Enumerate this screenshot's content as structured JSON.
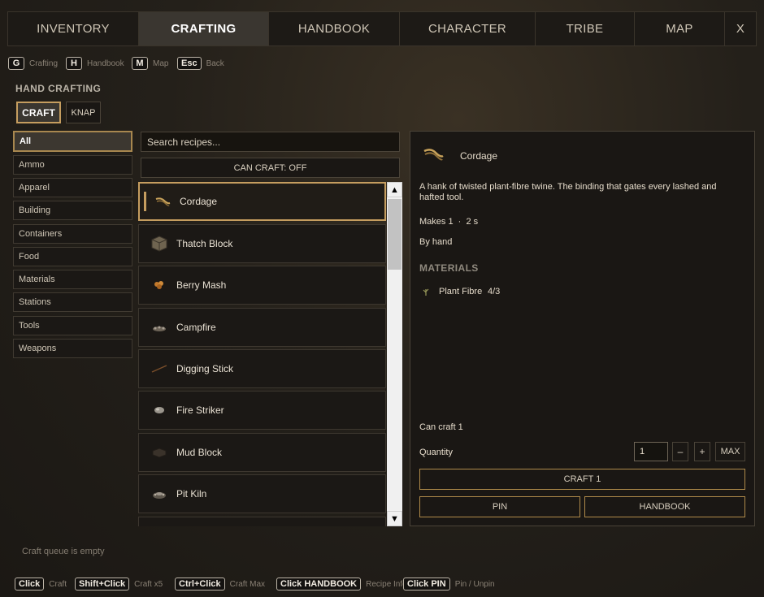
{
  "tabs": [
    "INVENTORY",
    "CRAFTING",
    "HANDBOOK",
    "CHARACTER",
    "TRIBE",
    "MAP"
  ],
  "close_label": "X",
  "key_hints": [
    {
      "key": "G",
      "label": "Crafting"
    },
    {
      "key": "H",
      "label": "Handbook"
    },
    {
      "key": "M",
      "label": "Map"
    },
    {
      "key": "Esc",
      "label": "Back"
    }
  ],
  "section_title": "HAND CRAFTING",
  "mode_buttons": {
    "craft": "CRAFT",
    "knap": "KNAP"
  },
  "categories": [
    "All",
    "Ammo",
    "Apparel",
    "Building",
    "Containers",
    "Food",
    "Materials",
    "Stations",
    "Tools",
    "Weapons"
  ],
  "search_placeholder": "Search recipes...",
  "can_craft_filter": "CAN CRAFT: OFF",
  "recipes": [
    {
      "name": "Cordage",
      "icon": "cordage-icon"
    },
    {
      "name": "Thatch Block",
      "icon": "thatch-block-icon"
    },
    {
      "name": "Berry Mash",
      "icon": "berry-mash-icon"
    },
    {
      "name": "Campfire",
      "icon": "campfire-icon"
    },
    {
      "name": "Digging Stick",
      "icon": "digging-stick-icon"
    },
    {
      "name": "Fire Striker",
      "icon": "fire-striker-icon"
    },
    {
      "name": "Mud Block",
      "icon": "mud-block-icon"
    },
    {
      "name": "Pit Kiln",
      "icon": "pit-kiln-icon"
    }
  ],
  "detail": {
    "name": "Cordage",
    "description": "A hank of twisted plant-fibre twine. The binding that gates every lashed and hafted tool.",
    "makes": "Makes 1  ·  2 s",
    "method": "By hand",
    "materials_title": "MATERIALS",
    "materials": [
      {
        "name": "Plant Fibre",
        "count": "4/3"
      }
    ],
    "can_craft": "Can craft 1",
    "quantity_label": "Quantity",
    "quantity_value": "1",
    "minus": "–",
    "plus": "+",
    "max": "MAX",
    "craft_button": "CRAFT 1",
    "pin_button": "PIN",
    "handbook_button": "HANDBOOK"
  },
  "queue_status": "Craft queue is empty",
  "bottom_hints": [
    {
      "key": "Click",
      "label": "Craft"
    },
    {
      "key": "Shift+Click",
      "label": "Craft x5"
    },
    {
      "key": "Ctrl+Click",
      "label": "Craft Max"
    },
    {
      "key": "Click HANDBOOK",
      "label": "Recipe Info"
    },
    {
      "key": "Click PIN",
      "label": "Pin / Unpin"
    }
  ],
  "colors": {
    "accent": "#c59d5f",
    "panel": "#1a1714",
    "active_tab": "#3a3630"
  }
}
